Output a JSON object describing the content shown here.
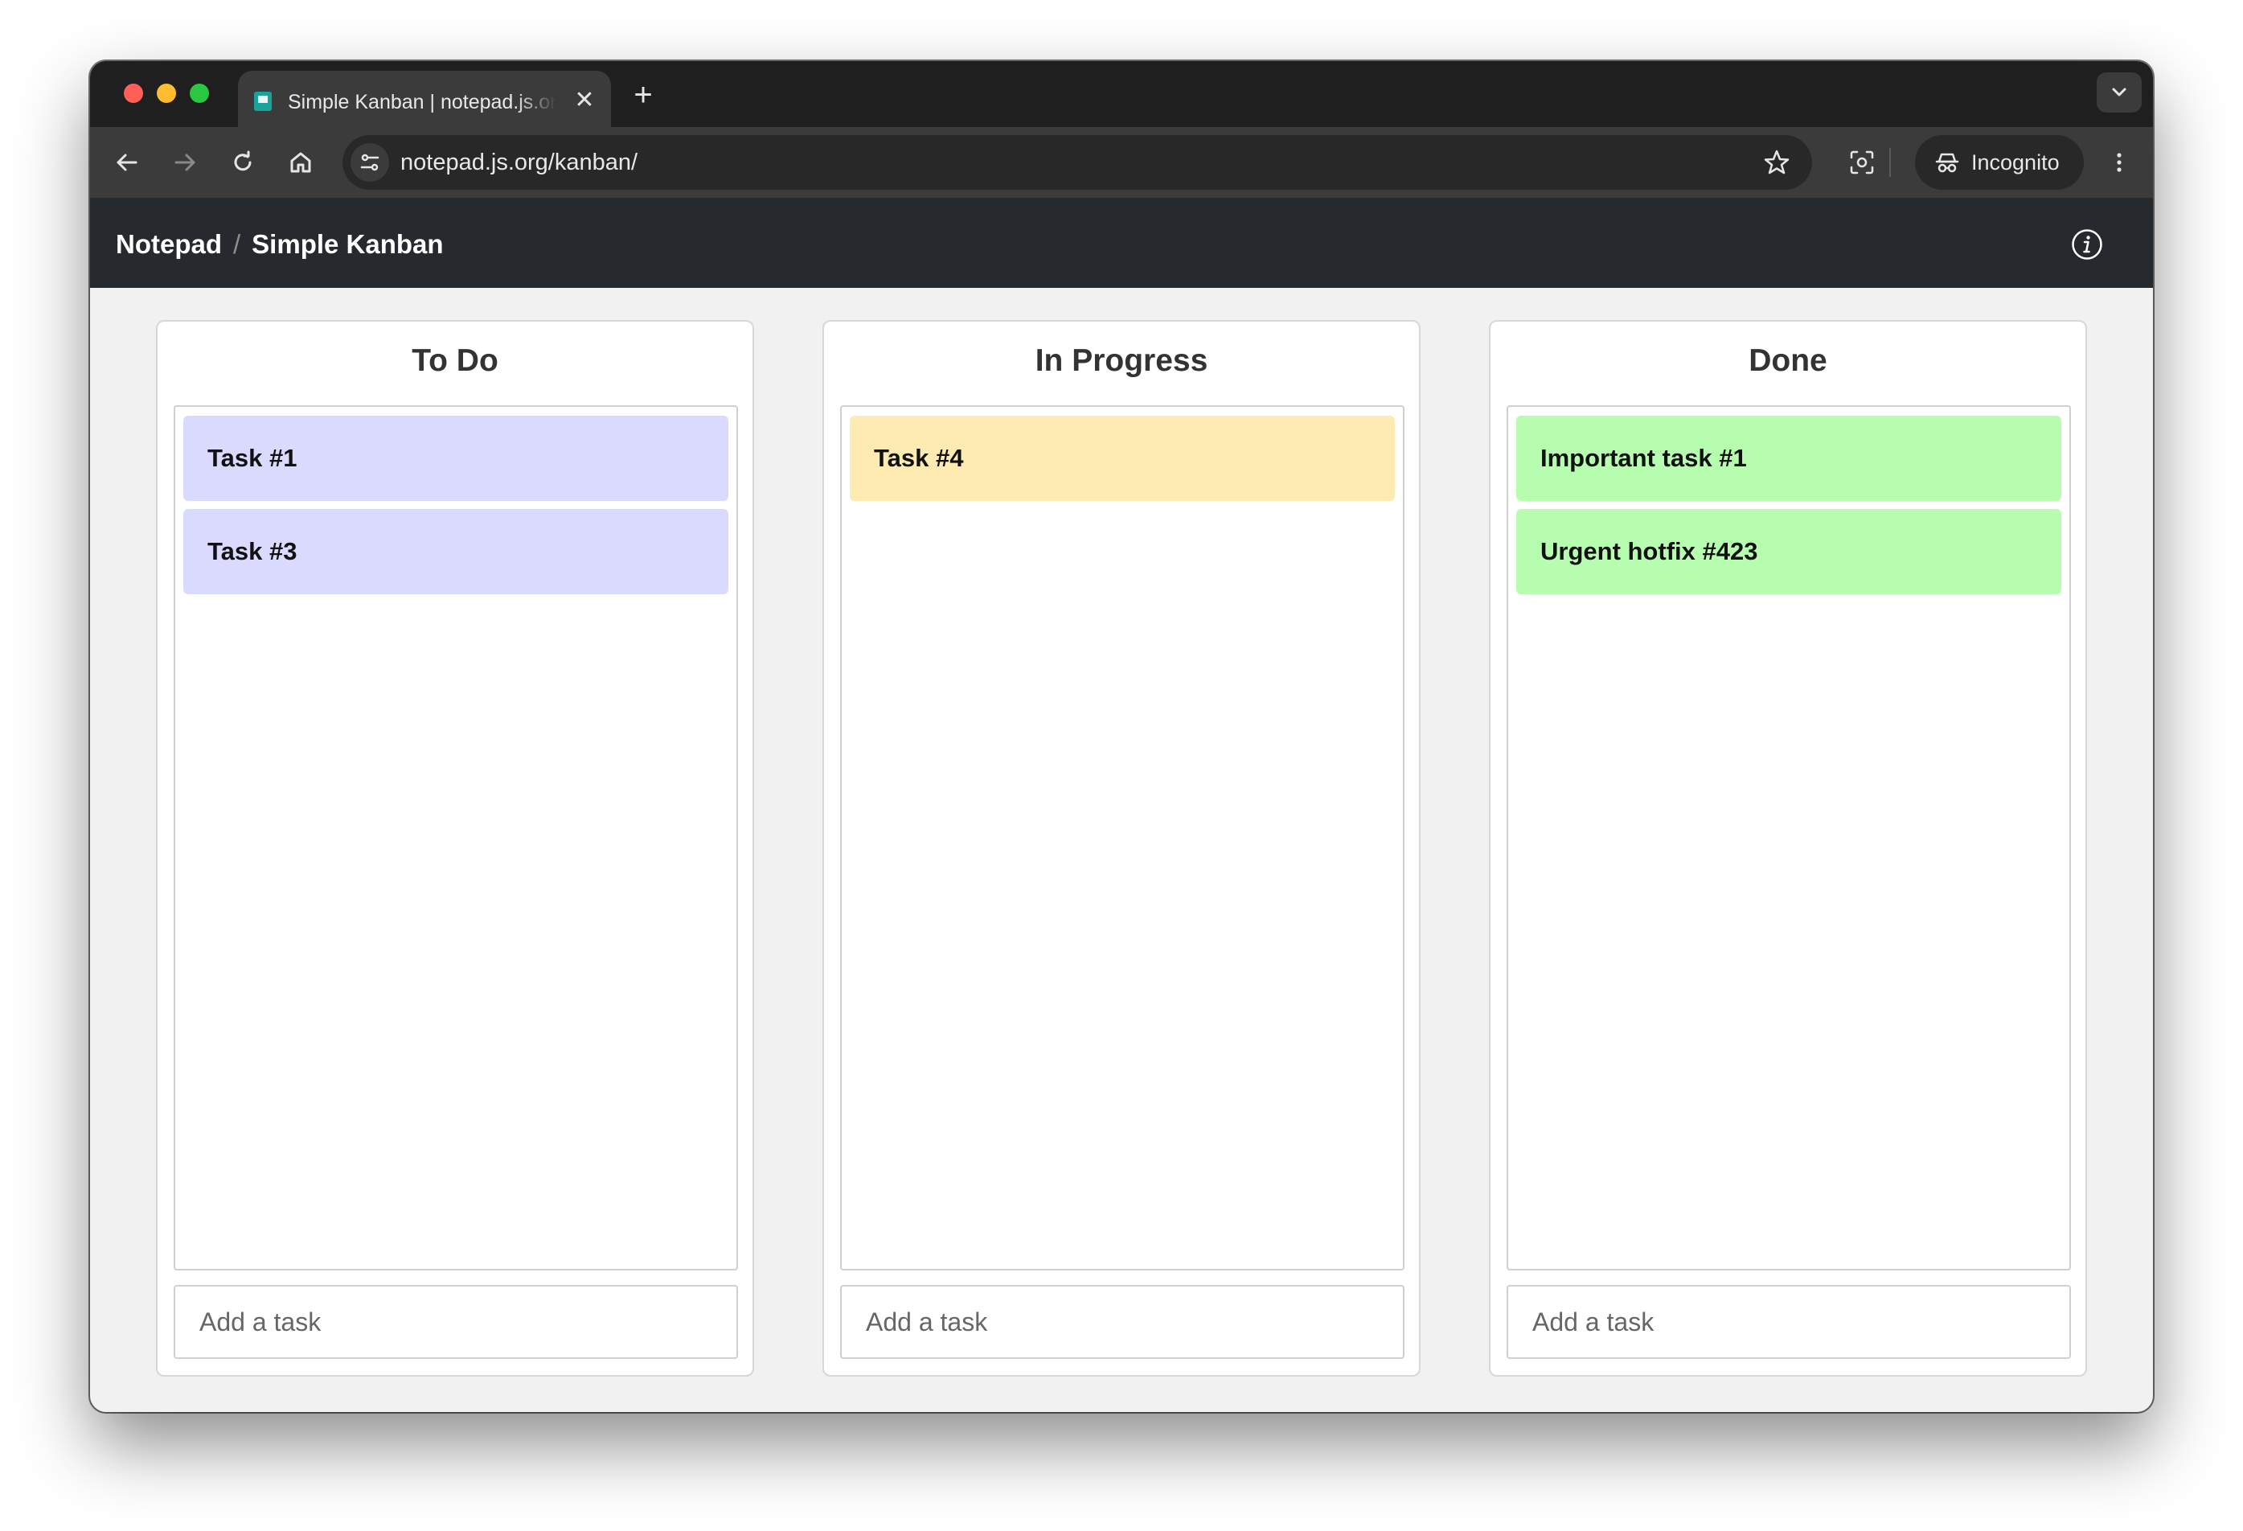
{
  "browser": {
    "tab_title": "Simple Kanban | notepad.js.org",
    "tab_close": "✕",
    "new_tab": "+",
    "url": "notepad.js.org/kanban/",
    "profile_label": "Incognito"
  },
  "header": {
    "breadcrumb_root": "Notepad",
    "breadcrumb_separator": "/",
    "breadcrumb_current": "Simple Kanban"
  },
  "board": {
    "columns": [
      {
        "title": "To Do",
        "card_color": "#d9dafd",
        "tasks": [
          "Task #1",
          "Task #3"
        ],
        "input_placeholder": "Add a task"
      },
      {
        "title": "In Progress",
        "card_color": "#fdebb1",
        "tasks": [
          "Task #4"
        ],
        "input_placeholder": "Add a task"
      },
      {
        "title": "Done",
        "card_color": "#b7fdb0",
        "tasks": [
          "Important task #1",
          "Urgent hotfix #423"
        ],
        "input_placeholder": "Add a task"
      }
    ]
  },
  "colors": {
    "header_bg": "#262a2e",
    "page_bg": "#f1f1f1",
    "browser_frame": "#1f1f1f"
  }
}
